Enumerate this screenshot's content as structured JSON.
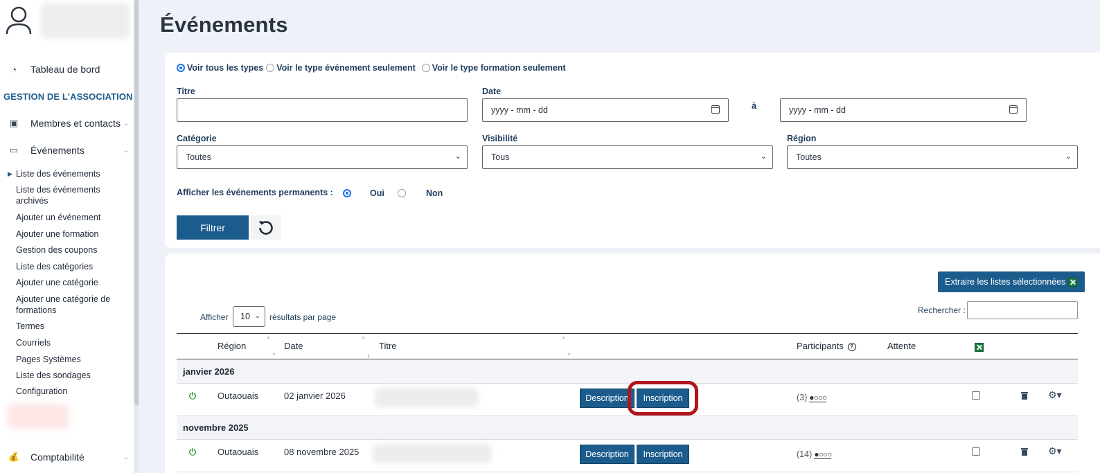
{
  "page": {
    "title": "Événements"
  },
  "sidebar": {
    "nav_top": {
      "label": "Tableau de bord",
      "icon": "gauge-icon"
    },
    "section_title": "GESTION DE L'ASSOCIATION",
    "members": {
      "label": "Membres et contacts",
      "icon": "contacts-icon"
    },
    "events": {
      "label": "Événements",
      "icon": "folder-open-icon"
    },
    "sub_items": [
      "Liste des événements",
      "Liste des événements archivés",
      "Ajouter un événement",
      "Ajouter une formation",
      "Gestion des coupons",
      "Liste des catégories",
      "Ajouter une catégorie",
      "Ajouter une catégorie de formations",
      "Termes",
      "Courriels",
      "Pages Systèmes",
      "Liste des sondages",
      "Configuration"
    ],
    "accounting": {
      "label": "Comptabilité",
      "icon": "money-bag-icon"
    }
  },
  "filters": {
    "type_options": [
      "Voir tous les types",
      "Voir le type événement seulement",
      "Voir le type formation seulement"
    ],
    "selected_type": "Voir tous les types",
    "title_label": "Titre",
    "title_value": "",
    "date_label": "Date",
    "date_from_placeholder": "yyyy - mm - dd",
    "date_to_label": "à",
    "date_to_placeholder": "yyyy - mm - dd",
    "category_label": "Catégorie",
    "category_value": "Toutes",
    "visibility_label": "Visibilité",
    "visibility_value": "Tous",
    "region_label": "Région",
    "region_value": "Toutes",
    "permanent_label": "Afficher les événements permanents :",
    "permanent_yes": "Oui",
    "permanent_no": "Non",
    "permanent_selected": "Oui",
    "filter_button": "Filtrer"
  },
  "list": {
    "extract_button": "Extraire les listes sélectionnées",
    "show_label": "Afficher",
    "per_page_value": "10",
    "per_page_suffix": "résultats par page",
    "search_label": "Rechercher :",
    "search_value": "",
    "columns": {
      "region": "Région",
      "date": "Date",
      "title": "Titre",
      "participants": "Participants",
      "waiting": "Attente"
    },
    "groups": [
      {
        "label": "janvier 2026",
        "rows": [
          {
            "region": "Outaouais",
            "date": "02 janvier 2026",
            "description_btn": "Description",
            "inscription_btn": "Inscription",
            "participants": "(3)"
          }
        ]
      },
      {
        "label": "novembre 2025",
        "rows": [
          {
            "region": "Outaouais",
            "date": "08 novembre 2025",
            "description_btn": "Description",
            "inscription_btn": "Inscription",
            "participants": "(14)"
          }
        ]
      }
    ]
  },
  "colors": {
    "primary": "#1c5c8c",
    "highlight": "#b0151a",
    "active_green": "#2e9a3a",
    "background": "#eef2f8"
  }
}
